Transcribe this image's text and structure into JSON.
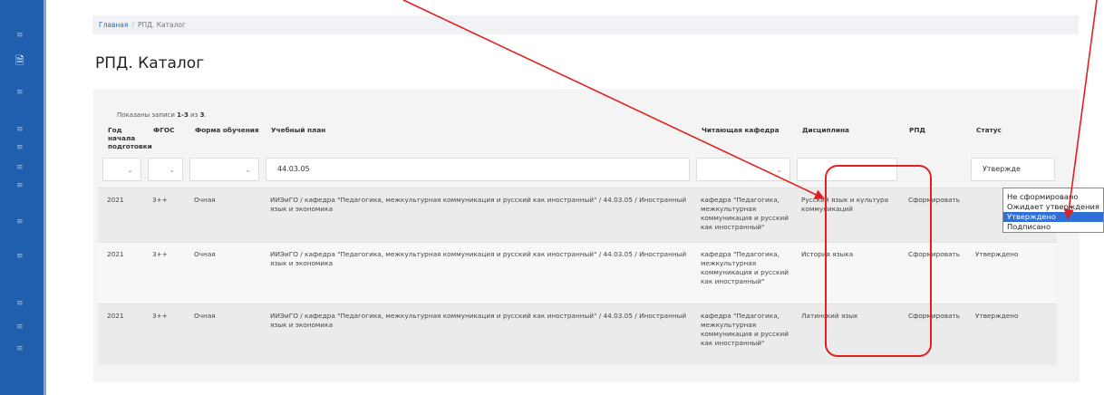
{
  "sidebar": {
    "icons": [
      "list-icon",
      "document-icon",
      "list-icon",
      "list-icon",
      "list-icon",
      "list-icon",
      "list-icon",
      "list-icon",
      "list-icon",
      "list-icon",
      "list-icon"
    ]
  },
  "breadcrumb": {
    "home": "Главная",
    "separator": "/",
    "current": "РПД. Каталог"
  },
  "page": {
    "title": "РПД. Каталог"
  },
  "summary": {
    "prefix": "Показаны записи ",
    "range": "1-3",
    "middle": " из ",
    "total": "3",
    "suffix": "."
  },
  "table": {
    "headers": [
      "Год начала подготовки",
      "ФГОС",
      "Форма обучения",
      "Учебный план",
      "Читающая кафедра",
      "Дисциплина",
      "РПД",
      "Статус"
    ],
    "filters": {
      "plan_value": "44.03.05",
      "status_value": "Утвержде"
    },
    "rows": [
      {
        "year": "2021",
        "fgos": "3++",
        "form": "Очная",
        "plan": "ИИЭиГО / кафедра \"Педагогика, межкультурная коммуникация и русский как иностранный\" / 44.03.05 / Иностранный язык и экономика",
        "dept": "кафедра \"Педагогика, межкультурная коммуникация и русский как иностранный\"",
        "discipline": "Русский язык и культура коммуникаций",
        "rpd": "Сформировать",
        "status": ""
      },
      {
        "year": "2021",
        "fgos": "3++",
        "form": "Очная",
        "plan": "ИИЭиГО / кафедра \"Педагогика, межкультурная коммуникация и русский как иностранный\" / 44.03.05 / Иностранный язык и экономика",
        "dept": "кафедра \"Педагогика, межкультурная коммуникация и русский как иностранный\"",
        "discipline": "История языка",
        "rpd": "Сформировать",
        "status": "Утверждено"
      },
      {
        "year": "2021",
        "fgos": "3++",
        "form": "Очная",
        "plan": "ИИЭиГО / кафедра \"Педагогика, межкультурная коммуникация и русский как иностранный\" / 44.03.05 / Иностранный язык и экономика",
        "dept": "кафедра \"Педагогика, межкультурная коммуникация и русский как иностранный\"",
        "discipline": "Латинский язык",
        "rpd": "Сформировать",
        "status": "Утверждено"
      }
    ]
  },
  "status_dropdown": {
    "options": [
      "Не сформировано",
      "Ожидает утверждения",
      "Утверждено",
      "Подписано"
    ],
    "selected": "Утверждено"
  },
  "colors": {
    "sidebar": "#1f5fad",
    "link": "#3a6ea5",
    "annotation": "#e32020",
    "selected_option": "#2f6fd6"
  }
}
